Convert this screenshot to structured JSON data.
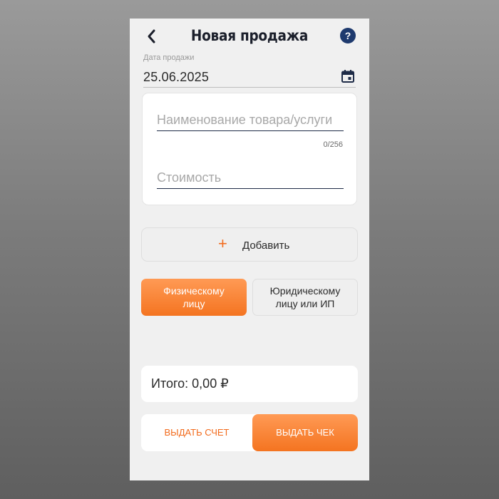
{
  "header": {
    "title": "Новая продажа",
    "back_icon": "chevron-left-icon",
    "help_icon": "question-circle-icon",
    "help_symbol": "?"
  },
  "sale_date": {
    "label": "Дата продажи",
    "value": "25.06.2025",
    "icon": "calendar-icon"
  },
  "item_form": {
    "name_placeholder": "Наименование товара/услуги",
    "name_counter": "0/256",
    "price_placeholder": "Стоимость"
  },
  "add_button": {
    "icon": "plus-icon",
    "symbol": "+",
    "label": "Добавить"
  },
  "buyer_type": {
    "selected": "physical",
    "options": [
      {
        "id": "physical",
        "line1": "Физическому",
        "line2": "лицу"
      },
      {
        "id": "legal",
        "line1": "Юридическому",
        "line2": "лицу или ИП"
      }
    ]
  },
  "total": {
    "text": "Итого: 0,00 ₽"
  },
  "actions": {
    "invoice_label": "ВЫДАТЬ СЧЕТ",
    "receipt_label": "ВЫДАТЬ ЧЕК"
  },
  "colors": {
    "accent": "#f47421",
    "help_badge": "#1e3a6e",
    "background": "#f0f0f0"
  }
}
